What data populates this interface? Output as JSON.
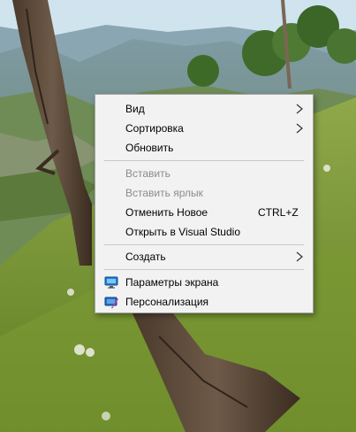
{
  "context_menu": {
    "items": [
      {
        "label": "Вид",
        "submenu_icon": "chevron-right-icon"
      },
      {
        "label": "Сортировка",
        "submenu_icon": "chevron-right-icon"
      },
      {
        "label": "Обновить"
      },
      {
        "label": "Вставить",
        "disabled": true
      },
      {
        "label": "Вставить ярлык",
        "disabled": true
      },
      {
        "label": "Отменить Новое",
        "shortcut": "CTRL+Z"
      },
      {
        "label": "Открыть в Visual Studio"
      },
      {
        "label": "Создать",
        "submenu_icon": "chevron-right-icon"
      },
      {
        "label": "Параметры экрана",
        "icon": "display-settings-icon"
      },
      {
        "label": "Персонализация",
        "icon": "personalization-icon"
      }
    ]
  },
  "colors": {
    "menu_background": "#f2f2f2",
    "menu_border": "#a0a0a0",
    "disabled_text": "#8c8c8c",
    "separator": "#c8c8c8"
  }
}
